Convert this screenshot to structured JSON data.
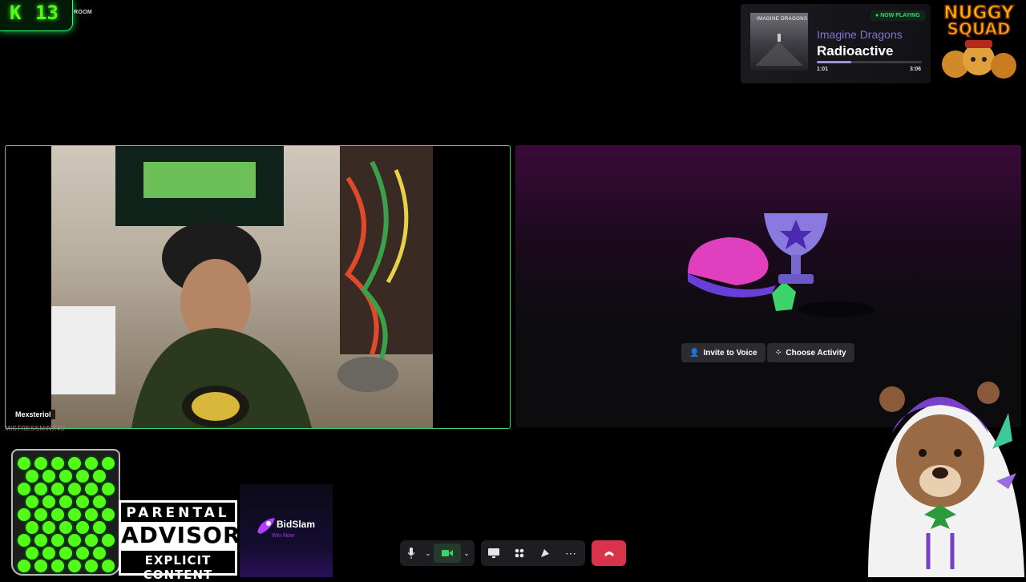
{
  "overlay": {
    "kick_counter": {
      "letter": "K",
      "count": "13"
    },
    "room_label": "ROOM"
  },
  "now_playing": {
    "badge": "NOW PLAYING",
    "album_art_title": "IMAGINE DRAGONS",
    "artist": "Imagine Dragons",
    "song": "Radioactive",
    "elapsed": "1:01",
    "duration": "3:06",
    "progress": 0.33
  },
  "logo": {
    "line1": "NUGGY",
    "line2": "SQUAD"
  },
  "call": {
    "participant_name": "Mexsteriol",
    "sub_label": "MISTRESSMINX4U",
    "activity_buttons": {
      "invite": "Invite to Voice",
      "choose": "Choose Activity"
    }
  },
  "widgets": {
    "advisory": {
      "line1": "PARENTAL",
      "line2": "ADVISORY",
      "line3": "EXPLICIT CONTENT"
    },
    "bidslam": {
      "name": "BidSlam",
      "tagline": "Win Now"
    }
  },
  "colors": {
    "kick_green": "#53fc18",
    "hangup_red": "#d8334a",
    "accent_purple": "#7f73d8"
  }
}
